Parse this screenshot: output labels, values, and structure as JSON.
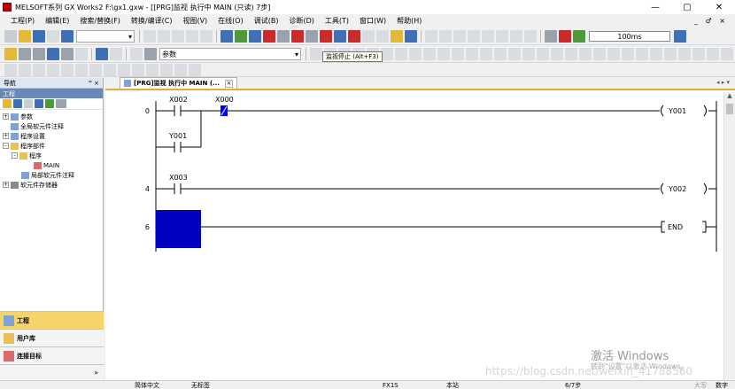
{
  "window": {
    "title": "MELSOFT系列 GX Works2 F:\\gx1.gxw - [[PRG]监视 执行中 MAIN (只读) 7步]",
    "controls": {
      "minimize": "—",
      "maximize": "▢",
      "close": "✕"
    }
  },
  "menu": {
    "items": [
      "工程(P)",
      "编辑(E)",
      "搜索/替换(F)",
      "转换/编译(C)",
      "视图(V)",
      "在线(O)",
      "调试(B)",
      "诊断(D)",
      "工具(T)",
      "窗口(W)",
      "帮助(H)"
    ],
    "right": "_ ♂ ×"
  },
  "toolbar": {
    "monitor_interval": "100ms",
    "param_combo": "参数",
    "tooltip": "监视停止 (Alt+F3)"
  },
  "nav": {
    "title": "导航",
    "pin": "ꟸ ×",
    "section": "工程",
    "tree": [
      {
        "label": "参数",
        "expander": "+"
      },
      {
        "label": "全局软元件注释",
        "expander": ""
      },
      {
        "label": "程序设置",
        "expander": "+"
      },
      {
        "label": "程序部件",
        "expander": "-"
      },
      {
        "label": "程序",
        "expander": "-"
      },
      {
        "label": "MAIN",
        "expander": ""
      },
      {
        "label": "局部软元件注释",
        "expander": ""
      },
      {
        "label": "软元件存储器",
        "expander": "+"
      }
    ],
    "buttons": [
      "工程",
      "用户库",
      "连接目标"
    ],
    "more": "»"
  },
  "editor": {
    "tab_label": "[PRG]监视 执行中 MAIN (...",
    "tab_close": "×",
    "tab_right": "◂ ▸ ▾",
    "rungs": [
      {
        "step": "0",
        "contacts": [
          "X002",
          "X000"
        ],
        "parallel": "Y001",
        "coil": "Y001"
      },
      {
        "step": "4",
        "contacts": [
          "X003"
        ],
        "coil": "Y002"
      },
      {
        "step": "6",
        "instruction": "END"
      }
    ]
  },
  "status": {
    "language": "简体中文",
    "title_state": "无标签",
    "plc": "FX1S",
    "connection": "本站",
    "steps": "6/7步",
    "ovr": "大写",
    "num": "数字"
  },
  "watermark": {
    "activate": "激活 Windows",
    "activate_sub": "转到\"设置\"以激活 Windows。",
    "blog": "https://blog.csdn.net/weixin_41788560"
  },
  "colors": {
    "active_contact": "#0000ff",
    "cursor": "#0000c0",
    "tab_accent": "#e8a93c",
    "nav_active": "#f7d46a"
  }
}
